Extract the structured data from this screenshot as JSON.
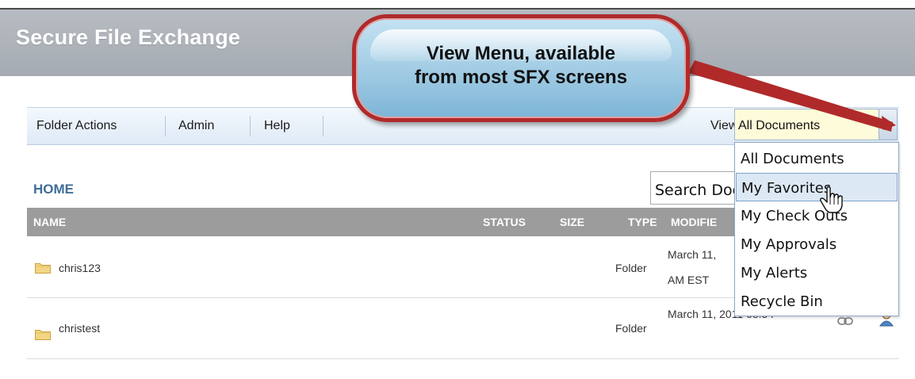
{
  "app": {
    "title": "Secure File Exchange"
  },
  "toolbar": {
    "items": [
      {
        "label": "Folder Actions"
      },
      {
        "label": "Admin"
      },
      {
        "label": "Help"
      }
    ],
    "view_label": "View:",
    "view_selected": "All Documents"
  },
  "view_menu": {
    "options": [
      {
        "label": "All Documents"
      },
      {
        "label": "My Favorites"
      },
      {
        "label": "My Check Outs"
      },
      {
        "label": "My Approvals"
      },
      {
        "label": "My Alerts"
      },
      {
        "label": "Recycle Bin"
      }
    ],
    "highlighted": "My Favorites"
  },
  "breadcrumb": {
    "home": "HOME"
  },
  "search": {
    "value": "Search Documents"
  },
  "table": {
    "columns": {
      "name": "NAME",
      "status": "STATUS",
      "size": "SIZE",
      "type": "TYPE",
      "modified": "MODIFIE"
    },
    "rows": [
      {
        "name": "chris123",
        "type": "Folder",
        "modified_line1": "March 11,",
        "modified_line2": "AM EST"
      },
      {
        "name": "christest",
        "type": "Folder",
        "modified_line1": "March 11, 2011 08:54"
      }
    ]
  },
  "callout": {
    "line1": "View Menu, available",
    "line2": "from most SFX screens"
  },
  "colors": {
    "header_bg": "#a9aeb4",
    "toolbar_bg": "#e6eef8",
    "table_header_bg": "#9c9c9c",
    "home_link": "#3f6e97",
    "callout_border": "#b02a2a",
    "callout_fill": "#a7cfe6",
    "select_bg": "#fdfbd9",
    "menu_highlight": "#dde8f5"
  },
  "icons": [
    "folder-icon",
    "chevron-down-icon",
    "hand-cursor-icon",
    "link-icon",
    "user-icon"
  ]
}
